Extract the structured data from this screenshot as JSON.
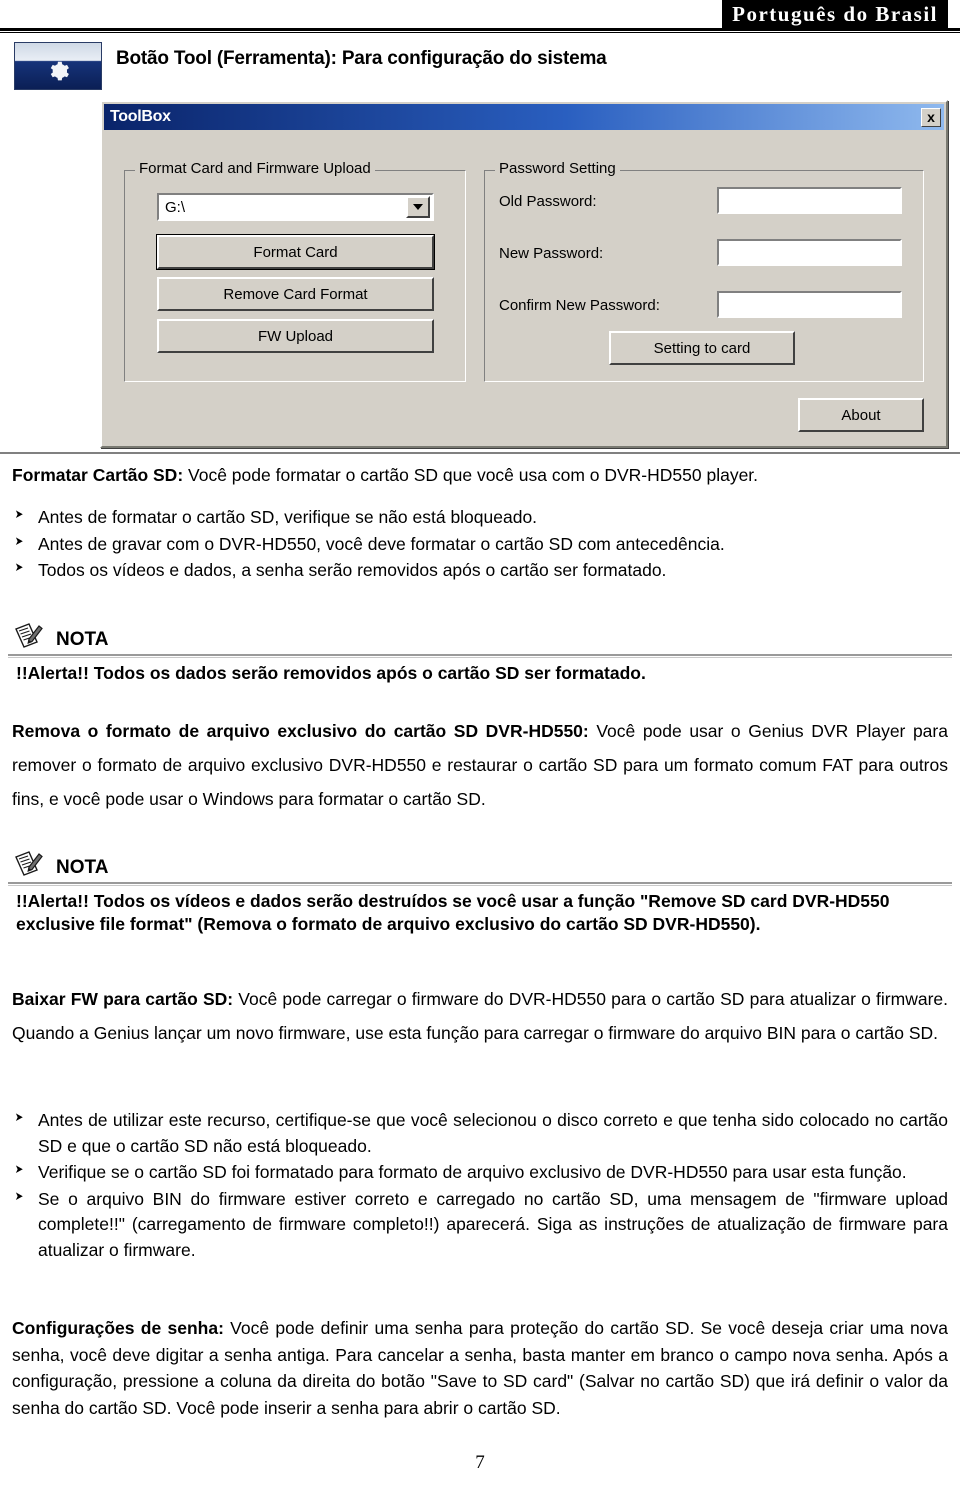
{
  "header": {
    "language_tag": "Português do Brasil"
  },
  "title_row": {
    "icon": "gear-icon",
    "heading": "Botão Tool (Ferramenta): Para configuração do sistema"
  },
  "dialog": {
    "window_title": "ToolBox",
    "close_label": "x",
    "format_group": {
      "legend": "Format Card and Firmware Upload",
      "drive_select_value": "G:\\",
      "buttons": [
        "Format Card",
        "Remove Card Format",
        "FW Upload"
      ]
    },
    "password_group": {
      "legend": "Password Setting",
      "fields": [
        {
          "label": "Old Password:",
          "value": ""
        },
        {
          "label": "New Password:",
          "value": ""
        },
        {
          "label": "Confirm New Password:",
          "value": ""
        }
      ],
      "submit_label": "Setting to card"
    },
    "about_label": "About"
  },
  "content": {
    "format_card": {
      "term": "Formatar Cartão SD:",
      "text": " Você pode formatar o cartão SD que você usa com o DVR-HD550 player.",
      "bullets": [
        "Antes de formatar o cartão SD, verifique se não está bloqueado.",
        "Antes de gravar com o DVR-HD550, você deve formatar o cartão SD com antecedência.",
        "Todos os vídeos e dados, a senha serão removidos após o cartão ser formatado."
      ]
    },
    "note_1": {
      "label": "NOTA",
      "text": "!!Alerta!! Todos os dados serão removidos após o cartão SD ser formatado."
    },
    "remove_format": {
      "term": "Remova o formato de arquivo exclusivo do cartão SD DVR-HD550:",
      "text": " Você pode usar o Genius DVR Player para remover o formato de arquivo exclusivo DVR-HD550 e restaurar o cartão SD para um formato comum FAT para outros fins, e você pode usar o Windows para formatar o cartão SD."
    },
    "note_2": {
      "label": "NOTA",
      "text": "!!Alerta!! Todos os vídeos e dados serão destruídos se você usar a função \"Remove SD card DVR-HD550 exclusive file format\" (Remova o formato de arquivo exclusivo do cartão SD DVR-HD550)."
    },
    "fw_upload": {
      "term": "Baixar FW para cartão SD:",
      "text": " Você pode carregar o firmware do DVR-HD550 para o cartão SD para atualizar o firmware. Quando a Genius lançar um novo firmware, use esta função para carregar o firmware do arquivo BIN para o cartão SD.",
      "bullets": [
        "Antes de utilizar este recurso, certifique-se que você selecionou o disco correto e que tenha sido colocado no cartão SD e que o cartão SD não está bloqueado.",
        "Verifique se o cartão SD foi formatado para formato de arquivo exclusivo de DVR-HD550 para usar esta função.",
        "Se o arquivo BIN do firmware estiver correto e carregado no cartão SD, uma mensagem de \"firmware upload complete!!\"  (carregamento de firmware completo!!) aparecerá. Siga as instruções de atualização de firmware para atualizar o firmware."
      ]
    },
    "password_settings": {
      "term": "Configurações de senha:",
      "text": " Você pode definir uma senha para proteção do cartão SD. Se você deseja criar uma nova senha, você deve digitar a senha antiga. Para cancelar a senha, basta manter em branco o campo nova senha. Após a configuração, pressione a coluna da direita do botão \"Save to SD card\" (Salvar no cartão SD) que irá definir o valor da senha do cartão SD. Você pode inserir a senha para abrir o cartão SD."
    }
  },
  "footer": {
    "page_number": "7"
  },
  "colors": {
    "dialog_face": "#d4d0c8",
    "titlebar_start": "#0a246a",
    "titlebar_end": "#8fb9ee",
    "icon_blue": "#0b1f55"
  }
}
